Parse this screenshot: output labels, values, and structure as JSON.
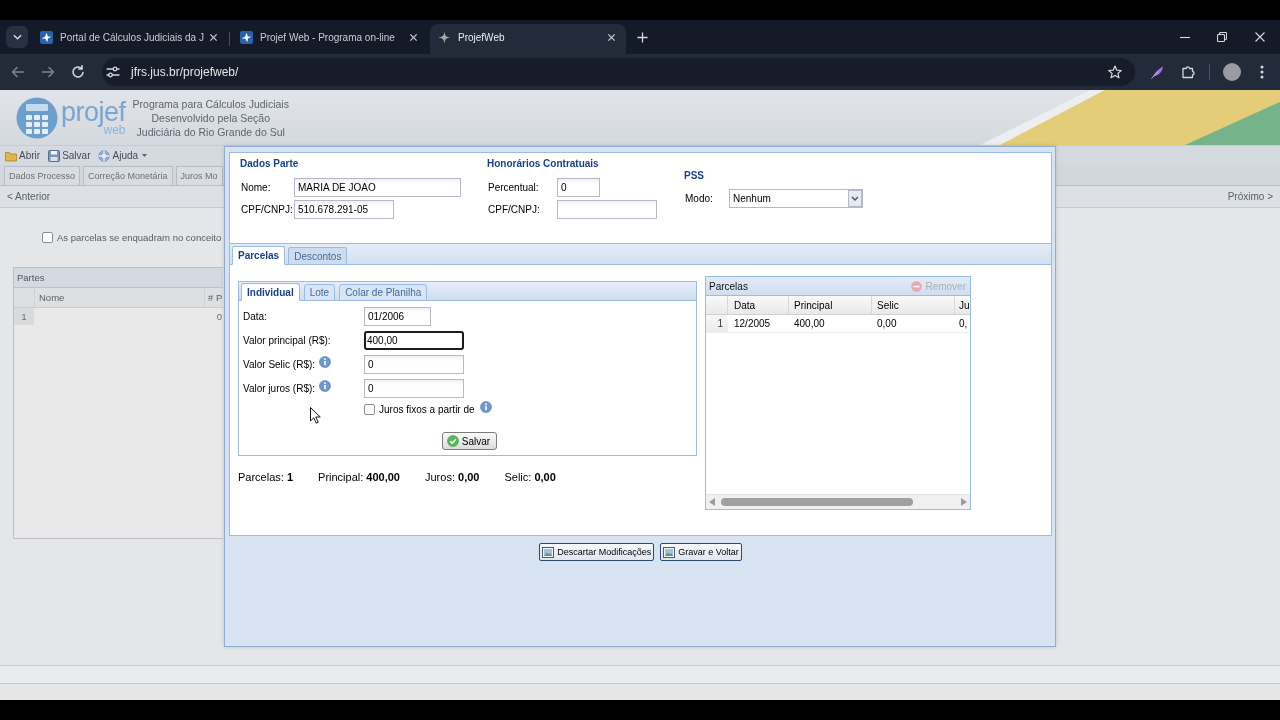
{
  "browser": {
    "tabs": [
      {
        "title": "Portal de Cálculos Judiciais da J",
        "kind": "portal",
        "selected": false
      },
      {
        "title": "Projef Web - Programa on-line",
        "kind": "portal",
        "selected": false
      },
      {
        "title": "ProjefWeb",
        "kind": "app",
        "selected": true
      }
    ],
    "url": "jfrs.jus.br/projefweb/"
  },
  "app": {
    "logo": {
      "wordmark": "projef",
      "suffix": "web"
    },
    "subtitle_lines": [
      "Programa para Cálculos Judiciais",
      "Desenvolvido pela Seção",
      "Judiciária do Rio Grande do Sul"
    ],
    "toolbar": [
      {
        "label": "Abrir",
        "kind": "open",
        "has_menu": false
      },
      {
        "label": "Salvar",
        "kind": "save",
        "has_menu": false
      },
      {
        "label": "Ajuda",
        "kind": "help",
        "has_menu": true
      }
    ],
    "tabs": [
      {
        "label": "Dados Processo",
        "selected": false
      },
      {
        "label": "Correção Monetária",
        "selected": false
      },
      {
        "label": "Juros Mo",
        "selected": false
      }
    ],
    "nav": {
      "previous": "< Anterior",
      "next": "Próximo >"
    },
    "checkbox": {
      "label": "As parcelas se enquadram no conceito",
      "checked": false
    },
    "parts_panel": {
      "title": "Partes",
      "columns": [
        "Nome",
        "# P"
      ],
      "rows": [
        {
          "number": "1",
          "column_2": "0"
        }
      ]
    }
  },
  "dialog": {
    "party": {
      "title": "Dados Parte",
      "fields": [
        {
          "label": "Nome:",
          "value": "MARIA DE JOAO",
          "kind": "name"
        },
        {
          "label": "CPF/CNPJ:",
          "value": "510.678.291-05",
          "kind": "document"
        }
      ]
    },
    "fees": {
      "title": "Honorários Contratuais",
      "fields": [
        {
          "label": "Percentual:",
          "value": "0",
          "kind": "percent"
        },
        {
          "label": "CPF/CNPJ:",
          "kind": "document"
        }
      ]
    },
    "pss": {
      "title": "PSS",
      "label": "Modo:",
      "value": "Nenhum"
    },
    "tabs": [
      {
        "label": "Parcelas",
        "selected": true
      },
      {
        "label": "Descontos",
        "selected": false
      }
    ],
    "entry_tabs": [
      {
        "label": "Individual",
        "selected": true
      },
      {
        "label": "Lote",
        "selected": false
      },
      {
        "label": "Colar de Planilha",
        "selected": false
      }
    ],
    "form": [
      {
        "label": "Data:",
        "value": "01/2006",
        "kind": "date",
        "focused": false,
        "info": false
      },
      {
        "label": "Valor principal (R$):",
        "value": "400,00",
        "kind": "amount",
        "focused": true,
        "info": false
      },
      {
        "label": "Valor Selic (R$):",
        "value": "0",
        "kind": "amount",
        "focused": false,
        "info": true
      },
      {
        "label": "Valor juros (R$):",
        "value": "0",
        "kind": "amount",
        "focused": false,
        "info": true
      }
    ],
    "fixed_interest": {
      "label": "Juros fixos a partir de",
      "checked": false,
      "info": true
    },
    "save_button": "Salvar",
    "summary": [
      "Parcelas: **1**",
      "Principal: **400,00**",
      "Juros: **0,00**",
      "Selic: **0,00**"
    ],
    "grid": {
      "title": "Parcelas",
      "remove_button": {
        "label": "Remover",
        "disabled": true
      },
      "columns": [
        "Data",
        "Principal",
        "Selic",
        "Ju"
      ],
      "rows": [
        {
          "number": "1",
          "cells": [
            "12/2005",
            "400,00",
            "0,00",
            "0,"
          ]
        }
      ]
    },
    "buttons": [
      "Descartar Modificações",
      "Gravar e Voltar"
    ]
  }
}
